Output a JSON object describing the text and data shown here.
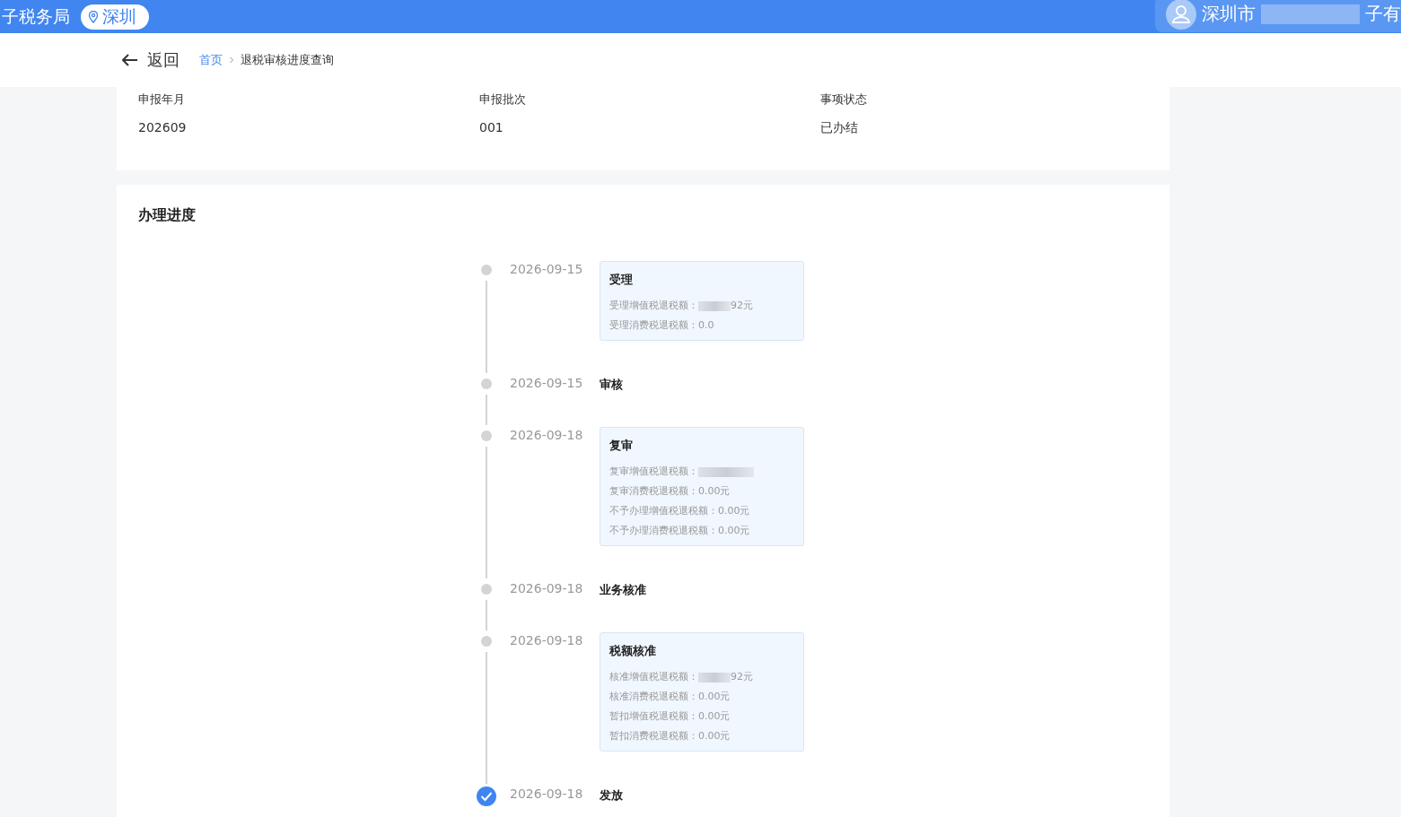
{
  "topbar": {
    "agency": "子税务局",
    "location": "深圳",
    "user_start": "深圳市",
    "user_end": "子有"
  },
  "nav": {
    "back": "返回",
    "breadcrumb": [
      {
        "label": "首页",
        "link": true
      },
      {
        "label": "退税审核进度查询",
        "link": false
      }
    ]
  },
  "summary": [
    {
      "label": "申报年月",
      "value": "202609"
    },
    {
      "label": "申报批次",
      "value": "001"
    },
    {
      "label": "事项状态",
      "value": "已办结"
    }
  ],
  "progress": {
    "title": "办理进度",
    "steps": [
      {
        "date": "2026-09-15",
        "title": "受理",
        "kind": "card",
        "done": false,
        "lines": [
          {
            "label": "受理增值税退税额：",
            "value": "92元",
            "redacted": true
          },
          {
            "label": "受理消费税退税额：",
            "value": "0.0",
            "redacted": false
          }
        ]
      },
      {
        "date": "2026-09-15",
        "title": "审核",
        "kind": "plain",
        "done": false
      },
      {
        "date": "2026-09-18",
        "title": "复审",
        "kind": "card",
        "done": false,
        "lines": [
          {
            "label": "复审增值税退税额：",
            "redacted": true
          },
          {
            "label": "复审消费税退税额：",
            "value": "0.00元",
            "redacted": false
          },
          {
            "label": "不予办理增值税退税额：",
            "value": "0.00元",
            "redacted": false
          },
          {
            "label": "不予办理消费税退税额：",
            "value": "0.00元",
            "redacted": false
          }
        ]
      },
      {
        "date": "2026-09-18",
        "title": "业务核准",
        "kind": "plain",
        "done": false
      },
      {
        "date": "2026-09-18",
        "title": "税额核准",
        "kind": "card",
        "done": false,
        "lines": [
          {
            "label": "核准增值税退税额：",
            "value": "92元",
            "redacted": true
          },
          {
            "label": "核准消费税退税额：",
            "value": "0.00元",
            "redacted": false
          },
          {
            "label": "暂扣增值税退税额：",
            "value": "0.00元",
            "redacted": false
          },
          {
            "label": "暂扣消费税退税额：",
            "value": "0.00元",
            "redacted": false
          }
        ]
      },
      {
        "date": "2026-09-18",
        "title": "发放",
        "kind": "plain",
        "done": true
      }
    ]
  }
}
